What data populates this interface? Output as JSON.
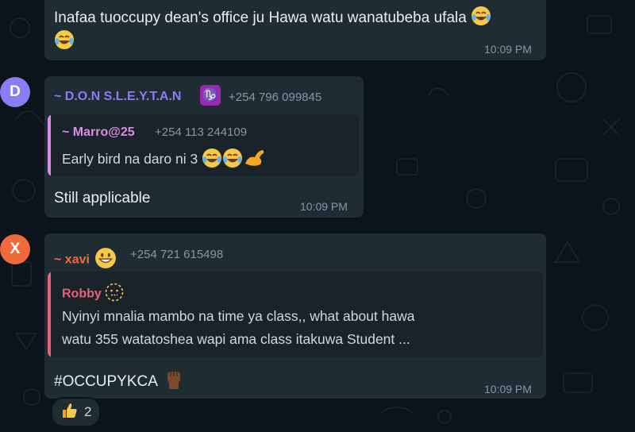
{
  "colors": {
    "background": "#0b141a",
    "bubble": "#202c33",
    "accent_don": "#8b7cf6",
    "accent_marro": "#d98be6",
    "accent_xavi": "#f06a3b",
    "accent_robby": "#e3647b"
  },
  "message1": {
    "line1": "Inafaa tuoccupy dean's office ju Hawa watu wanatubeba ufala",
    "time": "10:09 PM"
  },
  "message2": {
    "avatar_letter": "D",
    "sender": "~ D.O.N S.L.E.Y.T.A.N",
    "sender_badge": "♑",
    "phone": "+254 796 099845",
    "quote": {
      "name": "~ Marro@25",
      "phone": "+254 113 244109",
      "text": "Early bird na daro ni 3"
    },
    "text": "Still applicable",
    "time": "10:09 PM"
  },
  "message3": {
    "avatar_letter": "X",
    "sender": "~ xavi",
    "phone": "+254 721 615498",
    "quote": {
      "name": "Robby",
      "line1": "Nyinyi mnalia mambo na time ya class,, what about hawa",
      "line2": "watu 355 watatoshea wapi ama class itakuwa Student ..."
    },
    "text": "#OCCUPYKCA",
    "time": "10:09 PM",
    "reaction": {
      "icon": "thumbs-up-icon",
      "count": "2"
    }
  }
}
